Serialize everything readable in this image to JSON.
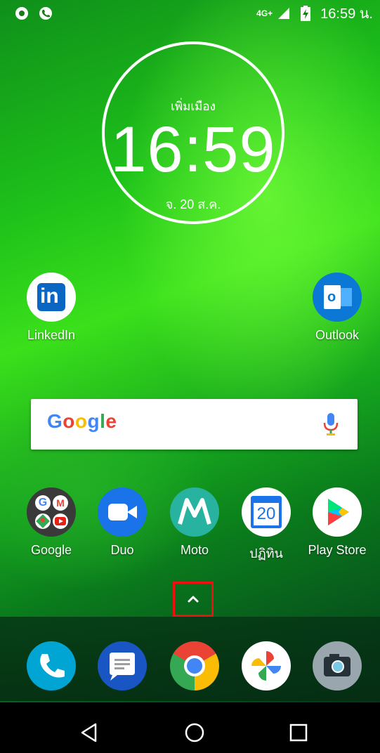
{
  "status_bar": {
    "network": "4G+",
    "time": "16:59 น."
  },
  "clock_widget": {
    "city": "เพิ่มเมือง",
    "time": "16:59",
    "date": "จ. 20 ส.ค."
  },
  "top_apps": [
    {
      "label": "LinkedIn",
      "icon": "linkedin-icon"
    },
    {
      "label": "Outlook",
      "icon": "outlook-icon"
    }
  ],
  "search": {
    "logo_text": "Google",
    "icon": "mic-icon"
  },
  "row_apps": [
    {
      "label": "Google",
      "icon": "google-folder-icon"
    },
    {
      "label": "Duo",
      "icon": "duo-icon"
    },
    {
      "label": "Moto",
      "icon": "moto-icon"
    },
    {
      "label": "ปฏิทิน",
      "icon": "calendar-icon",
      "day": "20"
    },
    {
      "label": "Play Store",
      "icon": "play-store-icon"
    }
  ],
  "dock": [
    {
      "icon": "phone-icon"
    },
    {
      "icon": "messages-icon"
    },
    {
      "icon": "chrome-icon"
    },
    {
      "icon": "photos-icon"
    },
    {
      "icon": "camera-icon"
    }
  ],
  "nav": [
    "back-icon",
    "home-icon",
    "recents-icon"
  ],
  "colors": {
    "linkedin": "#0a66c2",
    "outlook": "#0a78d4",
    "duo": "#1a73e8",
    "moto": "#27b3a0",
    "highlight": "#e11111"
  }
}
